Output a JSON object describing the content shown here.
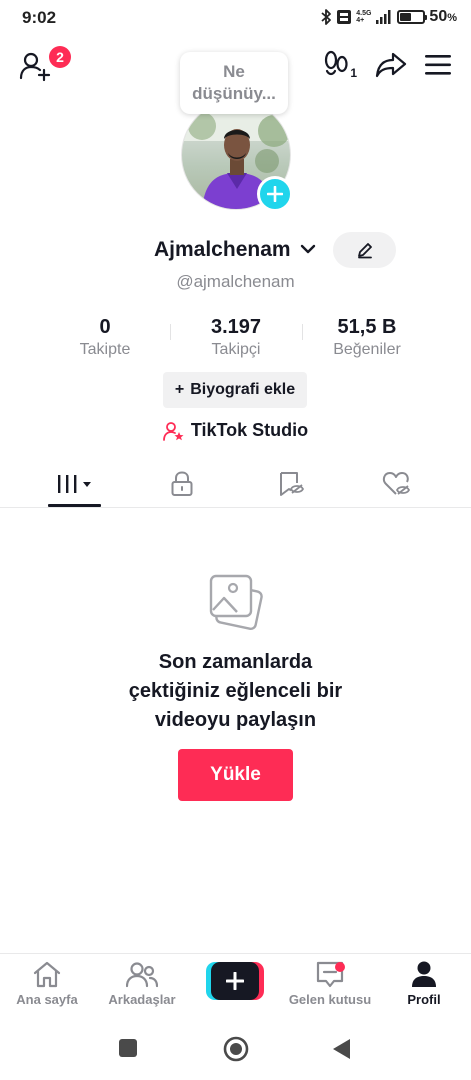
{
  "status": {
    "time": "9:02",
    "network_top": "4.5G",
    "network_bottom": "4+",
    "battery_percent": "50",
    "battery_unit": "%",
    "battery_level": 0.5
  },
  "topbar": {
    "notification_count": "2"
  },
  "footprint_count": "1",
  "thought": {
    "line1": "Ne",
    "line2": "düşünüy..."
  },
  "profile": {
    "username": "Ajmalchenam",
    "handle": "@ajmalchenam"
  },
  "stats": [
    {
      "value": "0",
      "label": "Takipte"
    },
    {
      "value": "3.197",
      "label": "Takipçi"
    },
    {
      "value": "51,5 B",
      "label": "Beğeniler"
    }
  ],
  "bio_button": {
    "plus": "+",
    "label": "Biyografi ekle"
  },
  "studio": {
    "label": "TikTok Studio"
  },
  "empty": {
    "line1": "Son zamanlarda",
    "line2": "çektiğiniz eğlenceli bir",
    "line3": "videoyu paylaşın",
    "upload": "Yükle"
  },
  "nav": {
    "home": "Ana sayfa",
    "friends": "Arkadaşlar",
    "inbox": "Gelen kutusu",
    "profile": "Profil"
  },
  "colors": {
    "accent": "#fe2c55",
    "cyan": "#20d5ec",
    "text": "#161823",
    "muted": "#8a8b91"
  }
}
